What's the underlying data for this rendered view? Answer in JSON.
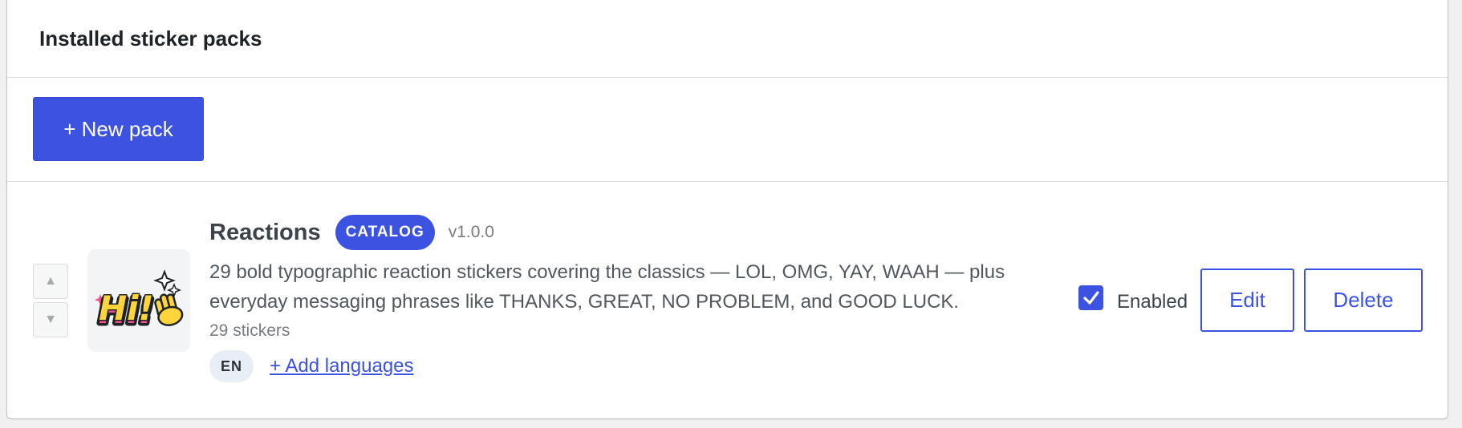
{
  "panel": {
    "title": "Installed sticker packs"
  },
  "toolbar": {
    "new_pack_label": "+ New pack"
  },
  "pack": {
    "move_up_icon": "triangle-up-icon",
    "move_down_icon": "triangle-down-icon",
    "thumbnail_icon": "hi-wave-sticker",
    "thumbnail_text": "Hi!",
    "name": "Reactions",
    "badge": "CATALOG",
    "version": "v1.0.0",
    "description": "29 bold typographic reaction stickers covering the classics — LOL, OMG, YAY, WAAH — plus everyday messaging phrases like THANKS, GREAT, NO PROBLEM, and GOOD LUCK.",
    "count": "29 stickers",
    "languages": [
      "EN"
    ],
    "add_languages_label": "+ Add languages",
    "enabled": true,
    "enabled_label": "Enabled",
    "edit_label": "Edit",
    "delete_label": "Delete"
  },
  "colors": {
    "accent": "#3c52e0",
    "lang_chip_bg": "#e8eef5",
    "sticker_yellow": "#ffd43b",
    "sticker_pink": "#ff4d8d"
  }
}
